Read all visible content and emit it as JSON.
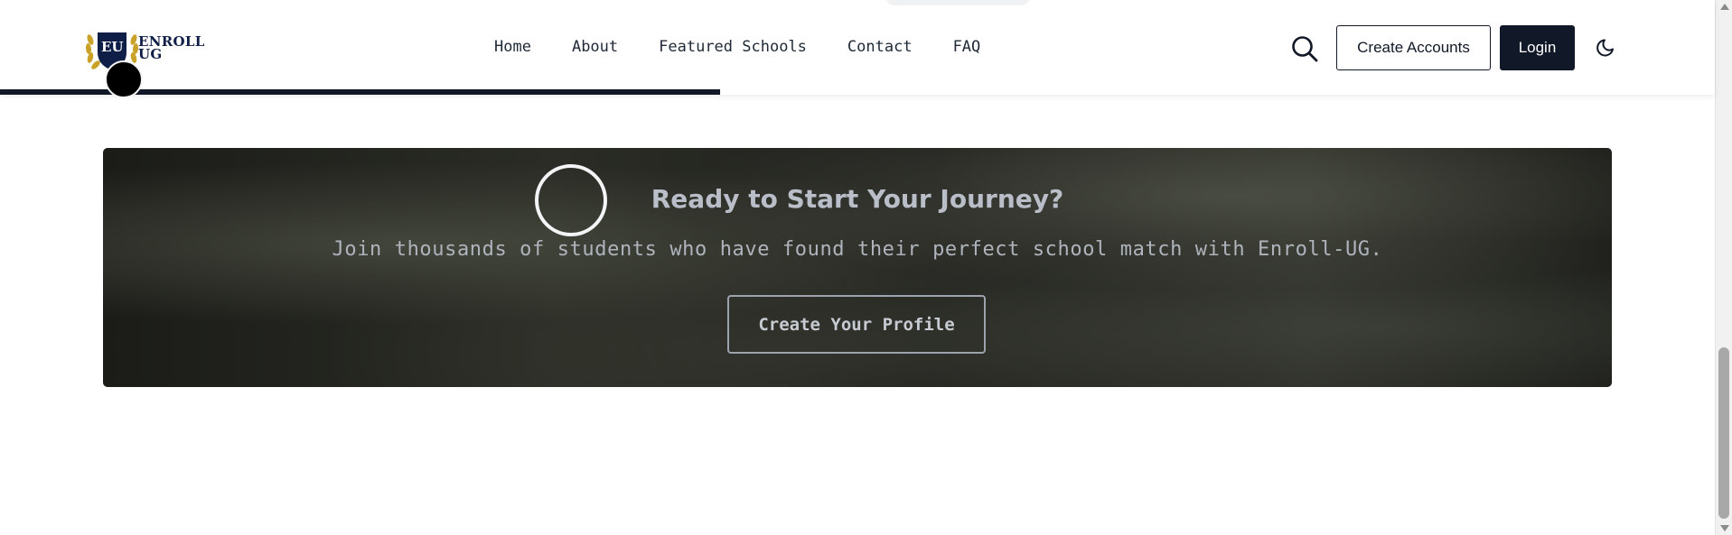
{
  "header": {
    "logo_text_line1": "ENROLL",
    "logo_text_line2": "UG",
    "logo_badge": "EU",
    "nav": [
      {
        "label": "Home"
      },
      {
        "label": "About"
      },
      {
        "label": "Featured Schools"
      },
      {
        "label": "Contact"
      },
      {
        "label": "FAQ"
      }
    ],
    "search_icon": "search-icon",
    "create_accounts_label": "Create Accounts",
    "login_label": "Login",
    "theme_icon": "moon-icon",
    "scroll_progress": 0.42
  },
  "cta": {
    "title": "Ready to Start Your Journey?",
    "subtitle": "Join thousands of students who have found their perfect school match with Enroll-UG.",
    "button_label": "Create Your Profile"
  },
  "colors": {
    "primary": "#111827",
    "logo_navy": "#0f1e46",
    "cta_text": "#b9bec8"
  }
}
